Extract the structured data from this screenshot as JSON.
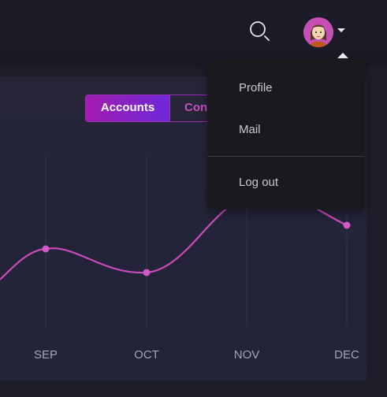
{
  "header": {
    "search_icon": "search-icon",
    "avatar_icon": "avatar-icon",
    "menu_caret_icon": "caret-down-icon"
  },
  "tabs": [
    {
      "label": "Accounts",
      "active": true
    },
    {
      "label": "Conn",
      "active": false
    }
  ],
  "user_menu": {
    "items": [
      {
        "label": "Profile"
      },
      {
        "label": "Mail"
      }
    ],
    "logout_label": "Log out"
  },
  "chart_data": {
    "type": "line",
    "categories": [
      "SEP",
      "OCT",
      "NOV",
      "DEC"
    ],
    "line_color": "#c94bb9",
    "point_color": "#d05bc6"
  },
  "colors": {
    "accent_start": "#a21caf",
    "accent_end": "#6d28d9",
    "accent_text": "#c84fbe"
  }
}
